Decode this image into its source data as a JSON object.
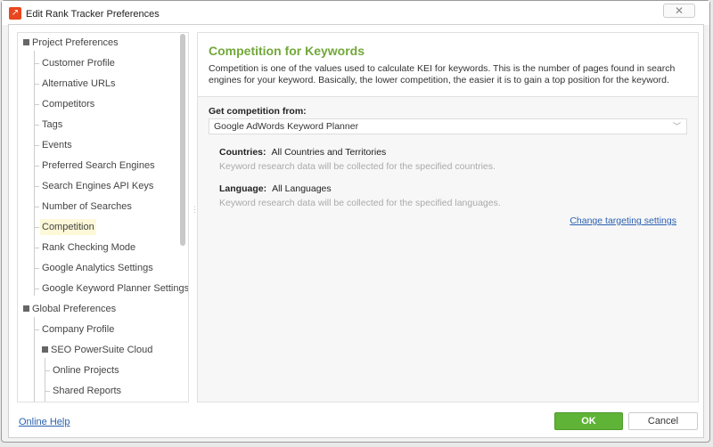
{
  "window": {
    "title": "Edit Rank Tracker Preferences",
    "close_icon": "close-icon"
  },
  "tree": [
    {
      "label": "Project Preferences",
      "level": 0,
      "expanded": true
    },
    {
      "label": "Customer Profile",
      "level": 1
    },
    {
      "label": "Alternative URLs",
      "level": 1
    },
    {
      "label": "Competitors",
      "level": 1
    },
    {
      "label": "Tags",
      "level": 1
    },
    {
      "label": "Events",
      "level": 1
    },
    {
      "label": "Preferred Search Engines",
      "level": 1
    },
    {
      "label": "Search Engines API Keys",
      "level": 1
    },
    {
      "label": "Number of Searches",
      "level": 1
    },
    {
      "label": "Competition",
      "level": 1,
      "selected": true
    },
    {
      "label": "Rank Checking Mode",
      "level": 1
    },
    {
      "label": "Google Analytics Settings",
      "level": 1
    },
    {
      "label": "Google Keyword Planner Settings",
      "level": 1
    },
    {
      "label": "Global Preferences",
      "level": 0,
      "expanded": true
    },
    {
      "label": "Company Profile",
      "level": 1
    },
    {
      "label": "SEO PowerSuite Cloud",
      "level": 1,
      "expanded": true
    },
    {
      "label": "Online Projects",
      "level": 2
    },
    {
      "label": "Shared Reports",
      "level": 2
    }
  ],
  "content": {
    "title": "Competition for Keywords",
    "description": "Competition is one of the values used to calculate KEI for keywords. This is the number of pages found in search engines for your keyword. Basically, the lower competition, the easier it is to gain a top position for the keyword.",
    "source_label": "Get competition from:",
    "source_value": "Google AdWords Keyword Planner",
    "countries_label": "Countries:",
    "countries_value": "All Countries and Territories",
    "countries_hint": "Keyword research data will be collected for the specified countries.",
    "language_label": "Language:",
    "language_value": "All Languages",
    "language_hint": "Keyword research data will be collected for the specified languages.",
    "change_link": "Change targeting settings"
  },
  "footer": {
    "help": "Online Help",
    "ok": "OK",
    "cancel": "Cancel"
  },
  "colors": {
    "accent": "#72a83a",
    "ok": "#5fb336",
    "link": "#2a5fb0"
  }
}
